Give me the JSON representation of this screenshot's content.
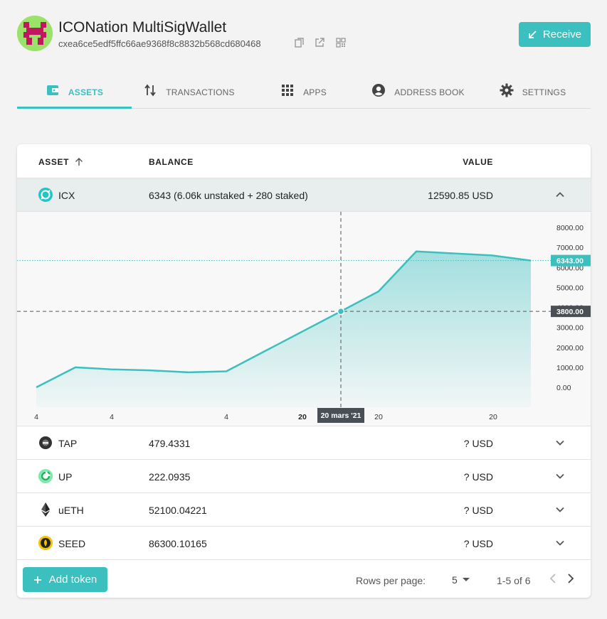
{
  "wallet": {
    "name": "ICONation MultiSigWallet",
    "address": "cxea6ce5edf5ffc66ae9368f8c8832b568cd680468",
    "receive_label": "Receive"
  },
  "tabs": [
    {
      "label": "ASSETS",
      "icon": "wallet-icon",
      "active": true
    },
    {
      "label": "TRANSACTIONS",
      "icon": "swap-vert-icon",
      "active": false
    },
    {
      "label": "APPS",
      "icon": "apps-grid-icon",
      "active": false
    },
    {
      "label": "ADDRESS BOOK",
      "icon": "account-circle-icon",
      "active": false
    },
    {
      "label": "SETTINGS",
      "icon": "gear-icon",
      "active": false
    }
  ],
  "table": {
    "headers": {
      "asset": "ASSET",
      "balance": "BALANCE",
      "value": "VALUE"
    },
    "rows": [
      {
        "symbol": "ICX",
        "balance": "6343 (6.06k unstaked + 280 staked)",
        "value": "12590.85 USD",
        "expanded": true,
        "icon": "icx-icon"
      },
      {
        "symbol": "TAP",
        "balance": "479.4331",
        "value": "? USD",
        "expanded": false,
        "icon": "tap-icon"
      },
      {
        "symbol": "UP",
        "balance": "222.0935",
        "value": "? USD",
        "expanded": false,
        "icon": "up-icon"
      },
      {
        "symbol": "uETH",
        "balance": "52100.04221",
        "value": "? USD",
        "expanded": false,
        "icon": "eth-icon"
      },
      {
        "symbol": "SEED",
        "balance": "86300.10165",
        "value": "? USD",
        "expanded": false,
        "icon": "seed-icon"
      }
    ]
  },
  "chart_data": {
    "type": "area",
    "y_ticks": [
      "8000.00",
      "7000.00",
      "6000.00",
      "5000.00",
      "4000.00",
      "3000.00",
      "2000.00",
      "1000.00",
      "0.00"
    ],
    "ylim": [
      0,
      8000
    ],
    "x_tick_labels": [
      "4",
      "4",
      "4",
      "20",
      "20",
      "20"
    ],
    "points": [
      0,
      1000,
      900,
      850,
      750,
      800,
      3800,
      4800,
      6800,
      6700,
      6600,
      6343
    ],
    "current_value_label": "6343.00",
    "crosshair_value_label": "3800.00",
    "crosshair_date_label": "20 mars '21",
    "crosshair_point_index": 6,
    "color": "#3bbfbf",
    "grid": false
  },
  "footer": {
    "add_token_label": "Add token",
    "rows_per_page_label": "Rows per page:",
    "rows_per_page_value": "5",
    "range_label": "1-5 of 6"
  },
  "colors": {
    "accent": "#3bbfbf",
    "background": "#f4f3f3",
    "expanded_row": "#e8eeee"
  }
}
